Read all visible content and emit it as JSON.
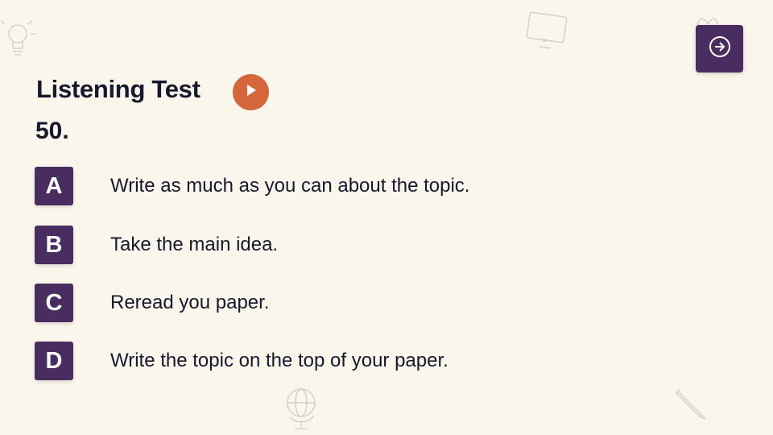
{
  "title": "Listening Test",
  "question_number": "50.",
  "options": [
    {
      "letter": "A",
      "text": "Write as much as you can about the topic."
    },
    {
      "letter": "B",
      "text": "Take the main idea."
    },
    {
      "letter": "C",
      "text": "Reread you paper."
    },
    {
      "letter": "D",
      "text": "Write the topic on the top of your paper."
    }
  ],
  "icons": {
    "next": "arrow-right-circle-icon",
    "play": "play-icon",
    "decorations": [
      "lightbulb-icon",
      "computer-monitor-icon",
      "globe-icon",
      "pencil-icon",
      "gift-icon"
    ]
  },
  "colors": {
    "background": "#faf6ec",
    "accent_purple": "#4a2d60",
    "play_orange": "#d4663a",
    "text": "#16182e"
  }
}
